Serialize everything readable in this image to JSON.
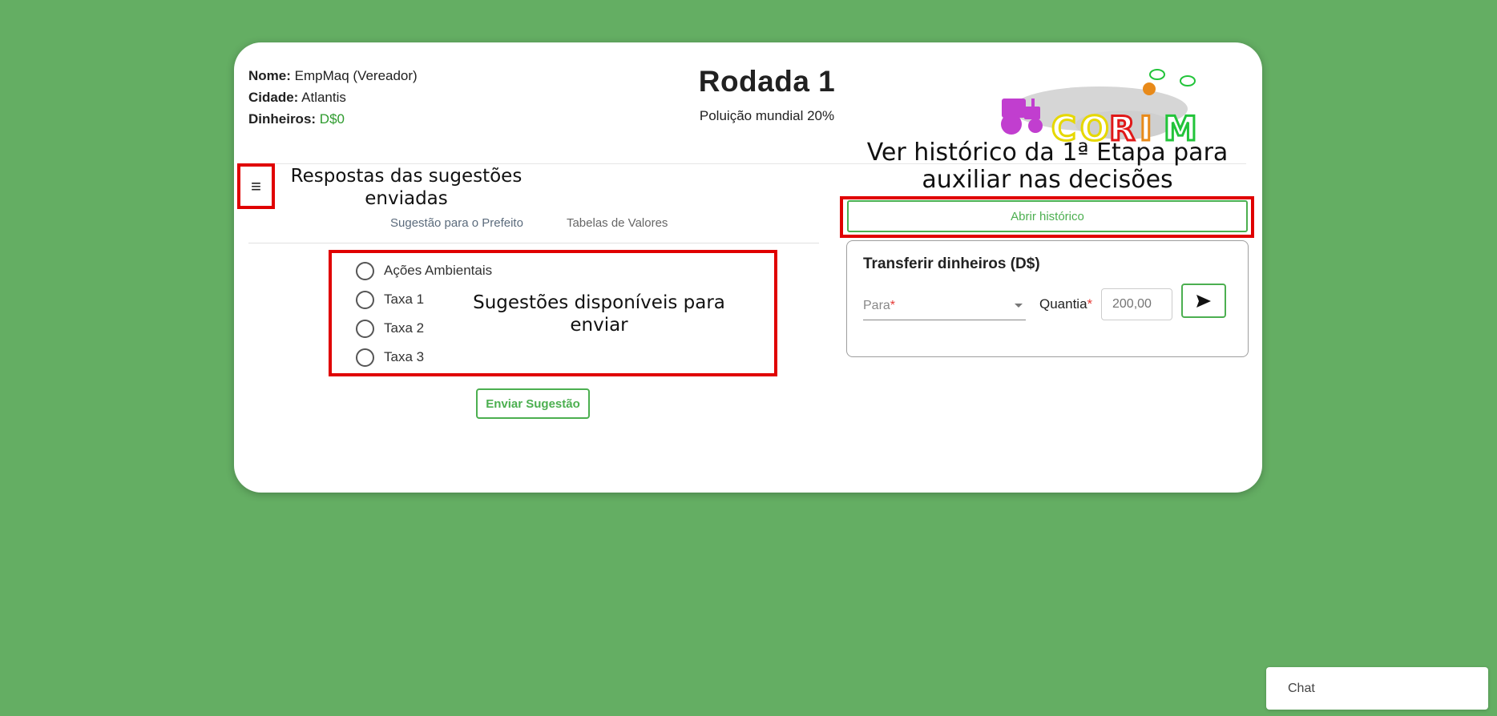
{
  "player": {
    "name_label": "Nome:",
    "name_value": "EmpMaq (Vereador)",
    "city_label": "Cidade:",
    "city_value": "Atlantis",
    "money_label": "Dinheiros:",
    "money_value": "D$0"
  },
  "round": {
    "title": "Rodada 1",
    "pollution": "Poluição mundial 20%"
  },
  "logo": {
    "letters": [
      "C",
      "O",
      "R",
      "I",
      "M"
    ]
  },
  "annotations": {
    "menu_hint": "Respostas das sugestões enviadas",
    "history_hint": "Ver histórico da 1ª Etapa para auxiliar nas decisões",
    "suggestions_hint": "Sugestões disponíveis para enviar"
  },
  "menu": {
    "icon": "hamburger-menu-icon"
  },
  "tabs": [
    {
      "label": "Sugestão para o Prefeito",
      "active": true
    },
    {
      "label": "Tabelas de Valores",
      "active": false
    }
  ],
  "suggestions": {
    "options": [
      "Ações Ambientais",
      "Taxa 1",
      "Taxa 2",
      "Taxa 3"
    ],
    "send_label": "Enviar Sugestão"
  },
  "history": {
    "button_label": "Abrir histórico"
  },
  "transfer": {
    "title": "Transferir dinheiros (D$)",
    "to_label": "Para",
    "required_mark": "*",
    "quantity_label": "Quantia",
    "quantity_placeholder": "200,00",
    "send_icon": "send-arrow-icon"
  },
  "chat": {
    "label": "Chat"
  },
  "colors": {
    "background": "#64ae63",
    "accent": "#4caf50",
    "annotation": "#e00000",
    "tab_indicator": "#3f51b5"
  }
}
